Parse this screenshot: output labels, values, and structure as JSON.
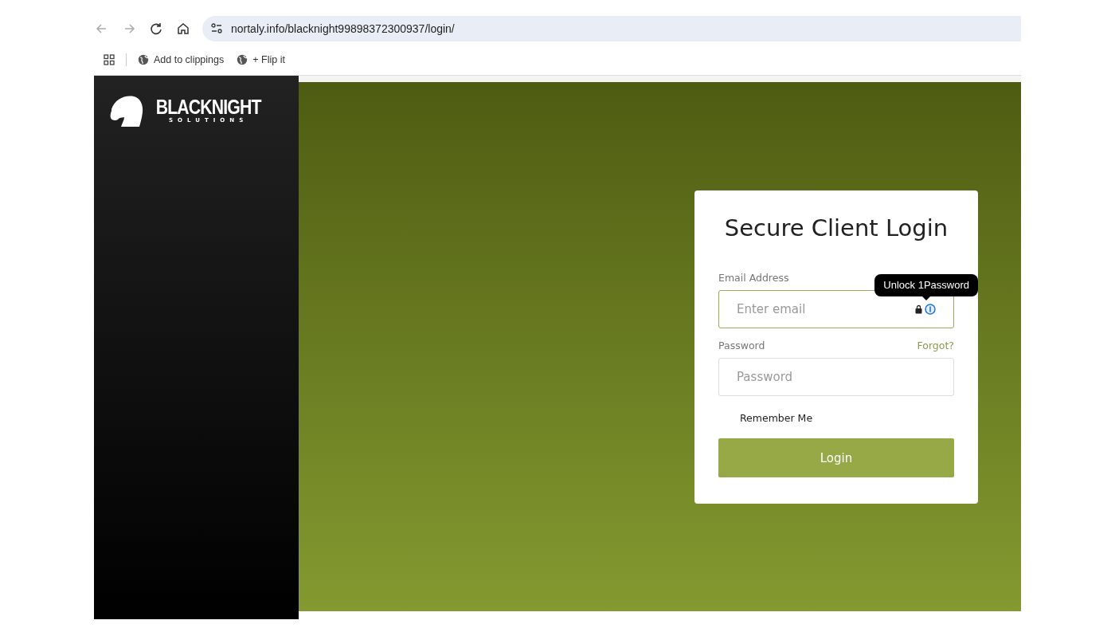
{
  "browser": {
    "url": "nortaly.info/blacknight99898372300937/login/",
    "bookmarks": [
      {
        "label": "Add to clippings"
      },
      {
        "label": "+ Flip it"
      }
    ]
  },
  "logo": {
    "name": "BLACKNIGHT",
    "tagline": "SOLUTIONS"
  },
  "login": {
    "title": "Secure Client Login",
    "email_label": "Email Address",
    "email_placeholder": "Enter email",
    "tooltip": "Unlock 1Password",
    "password_label": "Password",
    "forgot_link": "Forgot?",
    "password_placeholder": "Password",
    "remember_label": "Remember Me",
    "button": "Login"
  }
}
